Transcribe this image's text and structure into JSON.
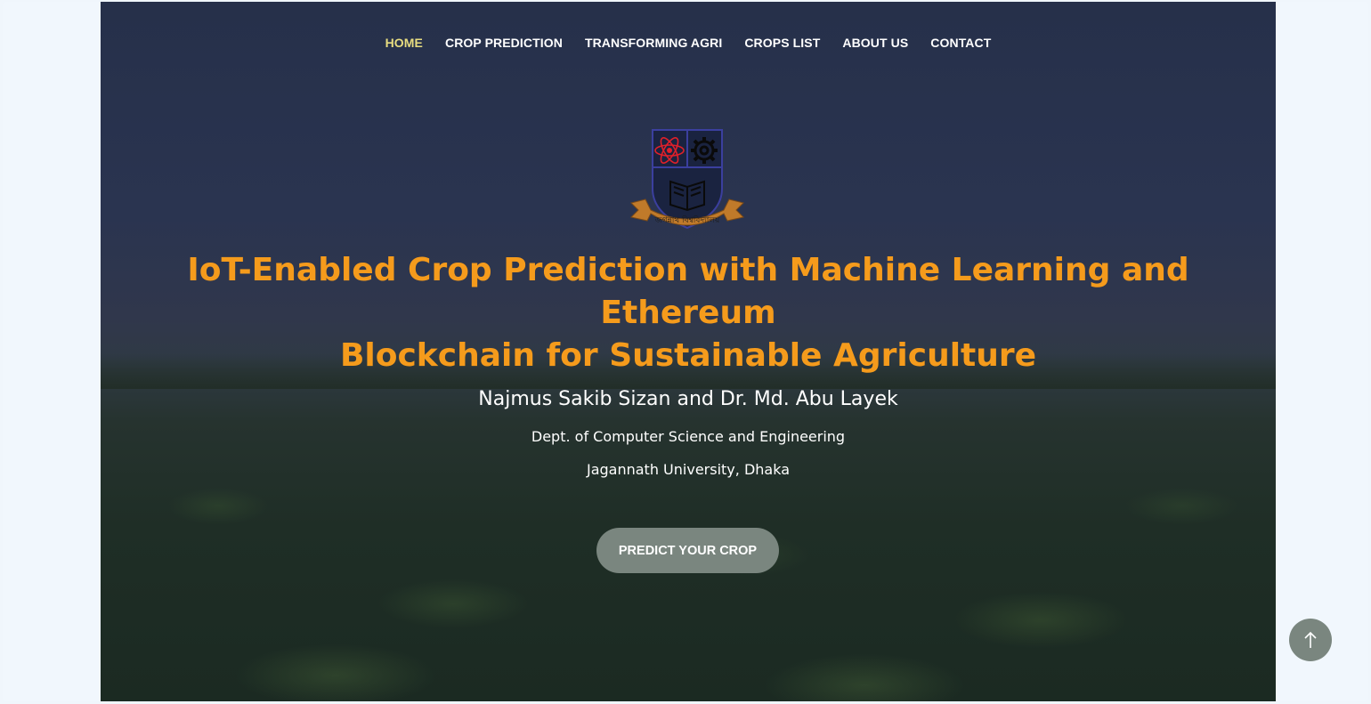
{
  "nav": {
    "items": [
      {
        "label": "HOME",
        "active": true
      },
      {
        "label": "CROP PREDICTION",
        "active": false
      },
      {
        "label": "TRANSFORMING AGRI",
        "active": false
      },
      {
        "label": "CROPS LIST",
        "active": false
      },
      {
        "label": "ABOUT US",
        "active": false
      },
      {
        "label": "CONTACT",
        "active": false
      }
    ]
  },
  "logo": {
    "icon": "university-crest-icon",
    "banner_text": "জগন্নাথ বিশ্ববিদ্যালয়"
  },
  "hero": {
    "title_line1": "IoT-Enabled Crop Prediction with Machine Learning and Ethereum",
    "title_line2": "Blockchain for Sustainable Agriculture",
    "authors": "Najmus Sakib Sizan and Dr. Md. Abu Layek",
    "department": "Dept. of Computer Science and Engineering",
    "university": "Jagannath University, Dhaka",
    "cta_label": "PREDICT YOUR CROP"
  },
  "scroll_top": {
    "icon": "arrow-up-icon"
  },
  "colors": {
    "accent": "#f59b1c",
    "nav_active": "#e8dd80",
    "button": "#7a867f"
  }
}
